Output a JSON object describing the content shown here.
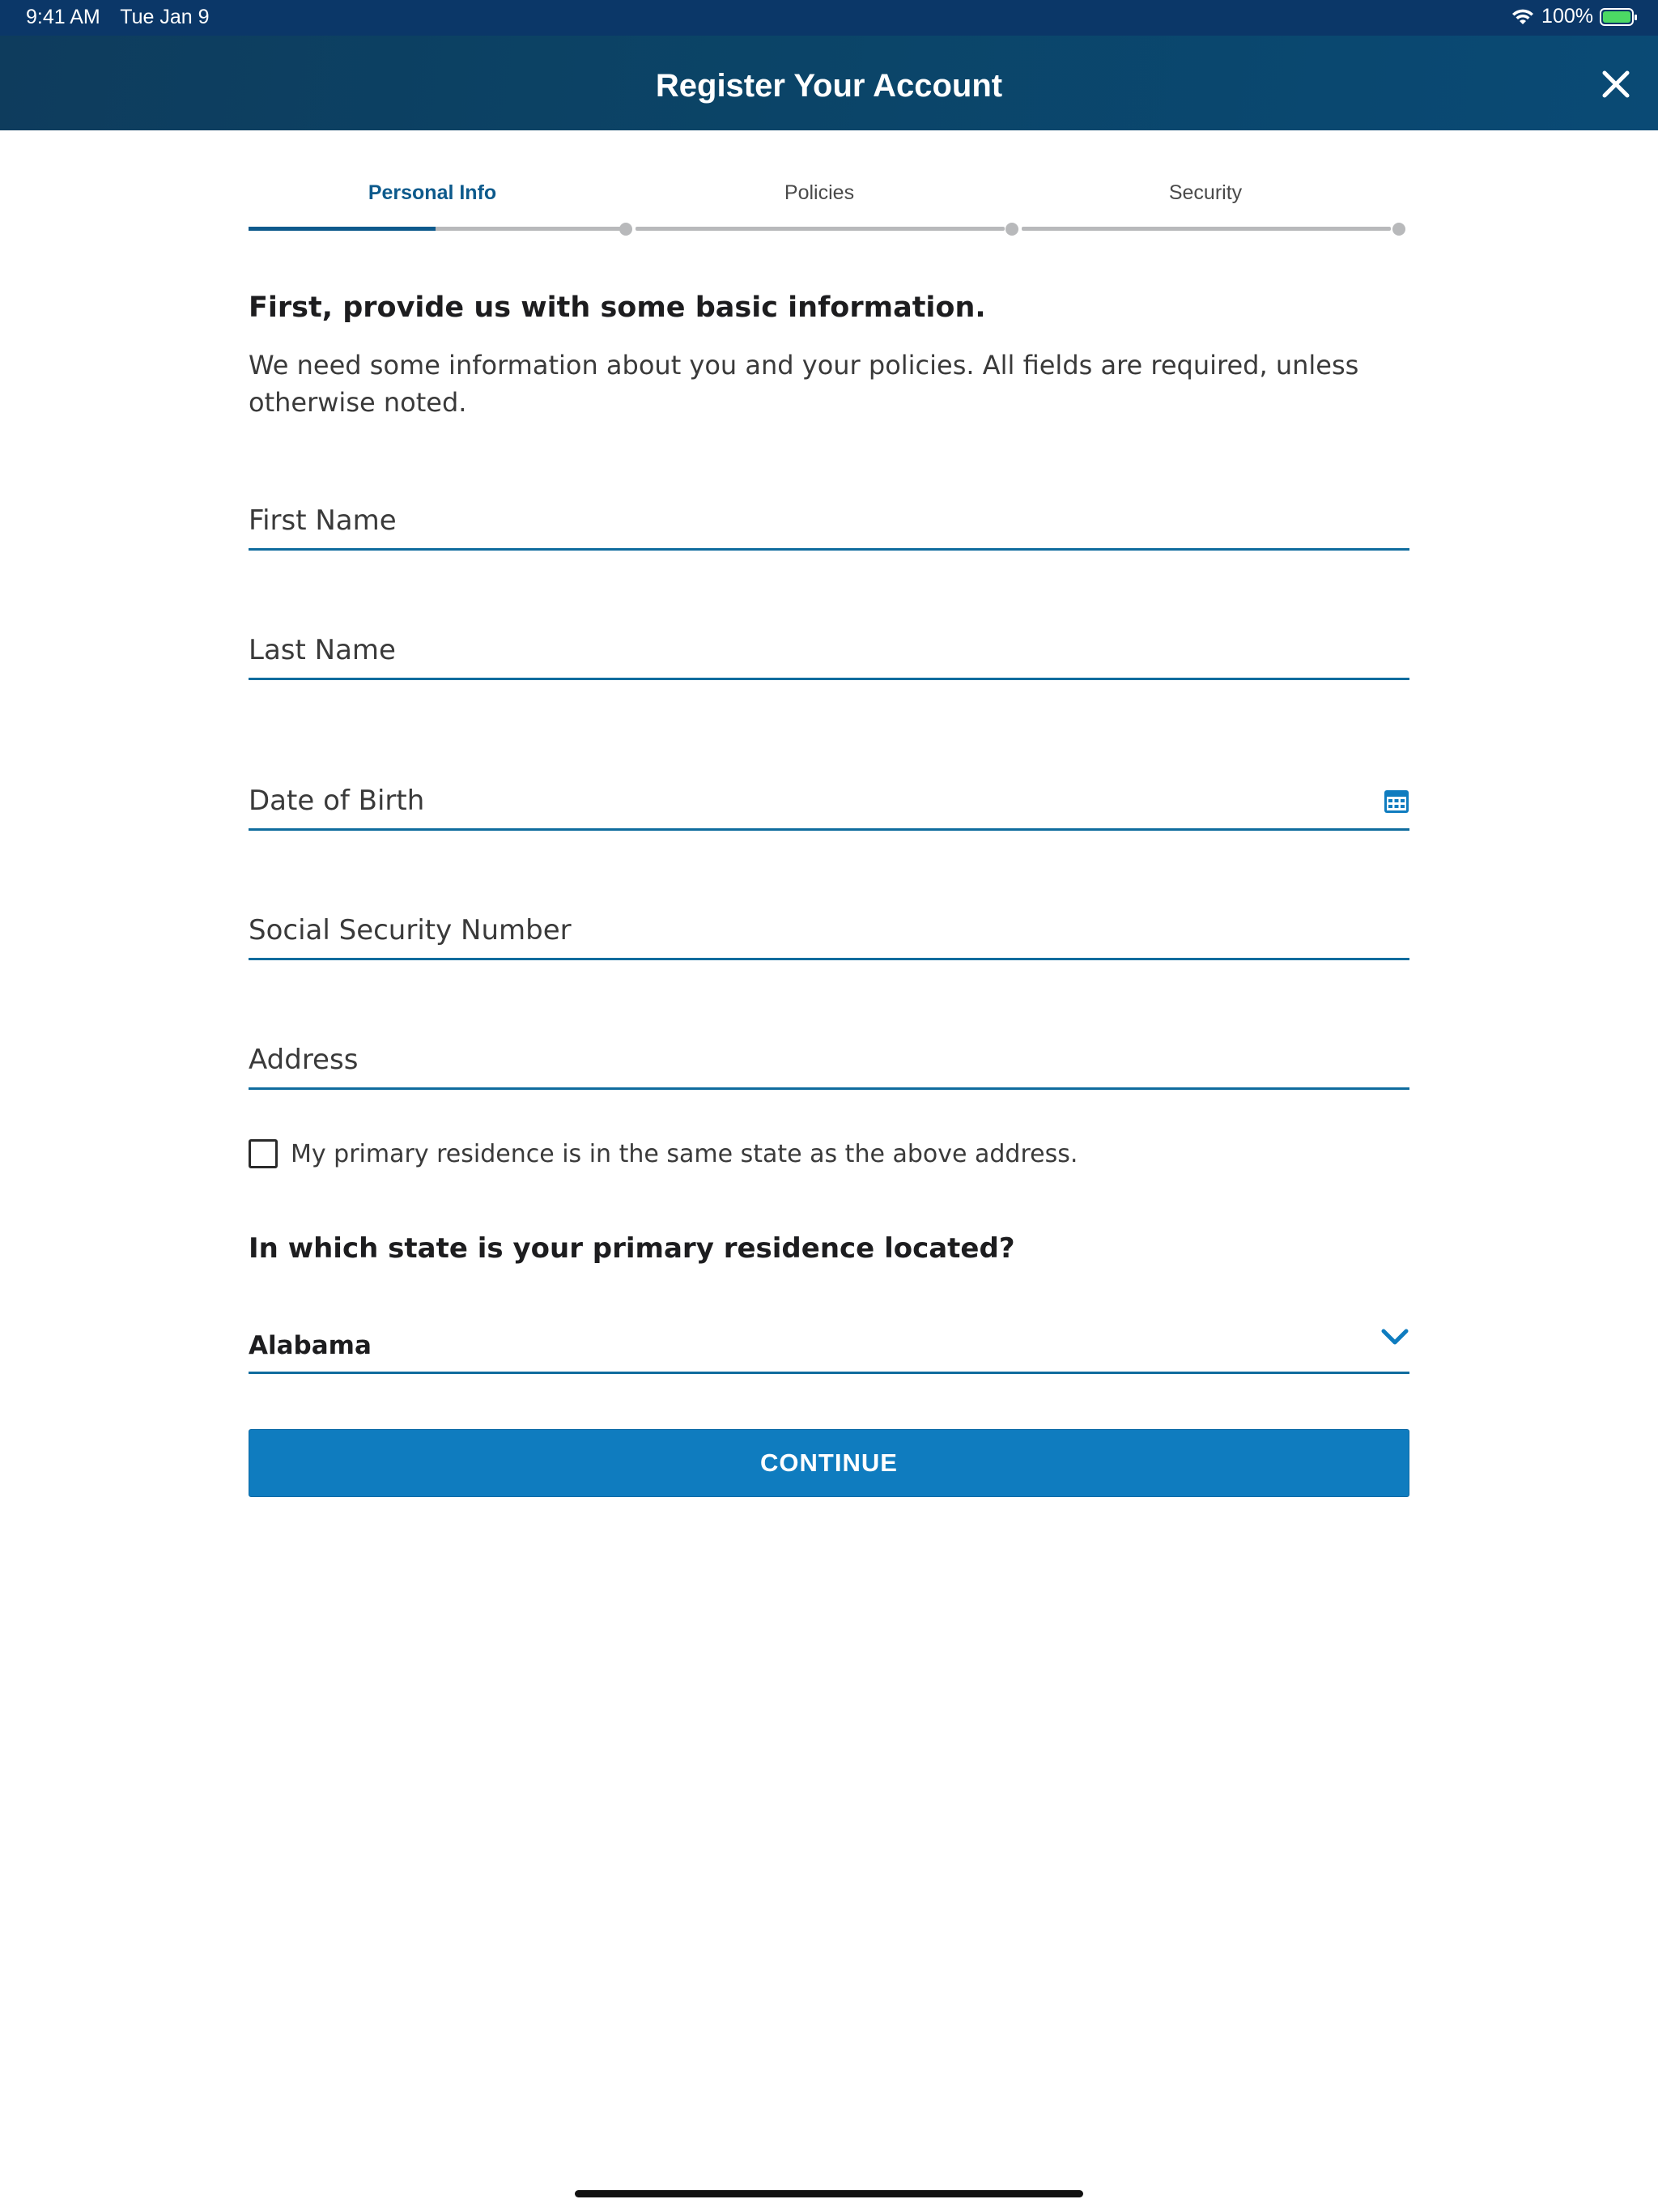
{
  "status_bar": {
    "time": "9:41 AM",
    "date": "Tue Jan 9",
    "battery": "100%",
    "battery_level": 1.0,
    "icons": [
      "wifi-icon",
      "battery-icon"
    ]
  },
  "header": {
    "title": "Register Your Account",
    "close_icon": "close-icon"
  },
  "stepper": {
    "steps": [
      {
        "label": "Personal Info",
        "active": true
      },
      {
        "label": "Policies",
        "active": false
      },
      {
        "label": "Security",
        "active": false
      }
    ],
    "current_step_progress": 0.5
  },
  "intro": {
    "heading": "First, provide us with some basic information.",
    "body": "We need some information about you and your policies. All fields are required, unless otherwise noted."
  },
  "form": {
    "first_name_placeholder": "First Name",
    "last_name_placeholder": "Last Name",
    "dob_placeholder": "Date of Birth",
    "ssn_placeholder": "Social Security Number",
    "address_placeholder": "Address",
    "same_state_label": "My primary residence is in the same state as the above address.",
    "same_state_checked": false,
    "state_question": "In which state is your primary residence located?",
    "state_value": "Alabama",
    "continue_label": "CONTINUE"
  },
  "colors": {
    "header_bg": "#0b4467",
    "status_bg": "#0b3768",
    "accent": "#0f7cbf",
    "active_step": "#0d5a8c",
    "field_underline": "#0f6c9e",
    "inactive_track": "#b8b9bb"
  }
}
